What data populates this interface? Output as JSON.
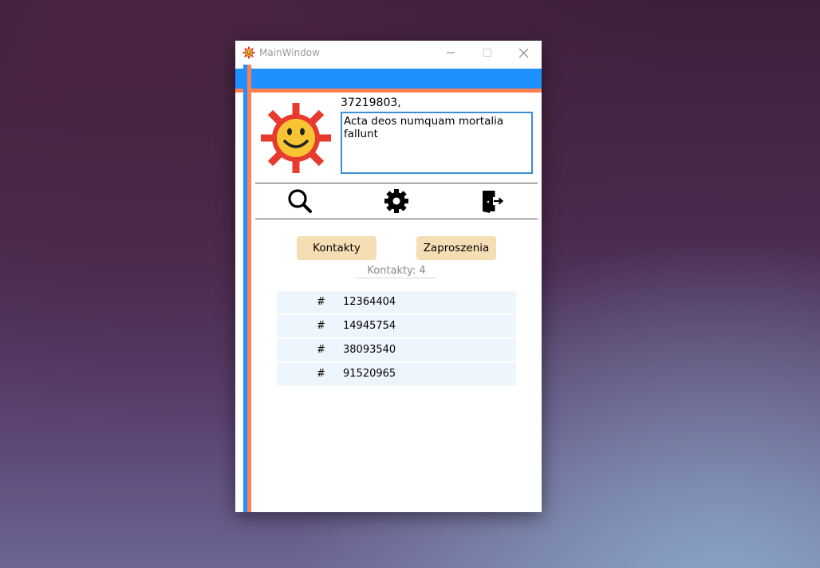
{
  "window": {
    "title": "MainWindow",
    "controls": {
      "minimize": "—",
      "maximize": "☐",
      "close": "✕"
    }
  },
  "colors": {
    "accent_blue": "#1e90ff",
    "accent_orange": "#ff7f50",
    "button_bg": "#f5deb3",
    "row_bg": "#eef6fd"
  },
  "profile": {
    "user_id": "37219803,",
    "status_text": "Acta deos numquam mortalia fallunt",
    "avatar_icon": "sun-smiley-icon"
  },
  "toolbar": {
    "icons": [
      "search-icon",
      "gear-icon",
      "exit-door-icon"
    ]
  },
  "tabs": {
    "contacts_label": "Kontakty",
    "invites_label": "Zaproszenia"
  },
  "contacts_count": "Kontakty: 4",
  "contacts": [
    {
      "hash": "#",
      "number": "12364404"
    },
    {
      "hash": "#",
      "number": "14945754"
    },
    {
      "hash": "#",
      "number": "38093540"
    },
    {
      "hash": "#",
      "number": "91520965"
    }
  ]
}
